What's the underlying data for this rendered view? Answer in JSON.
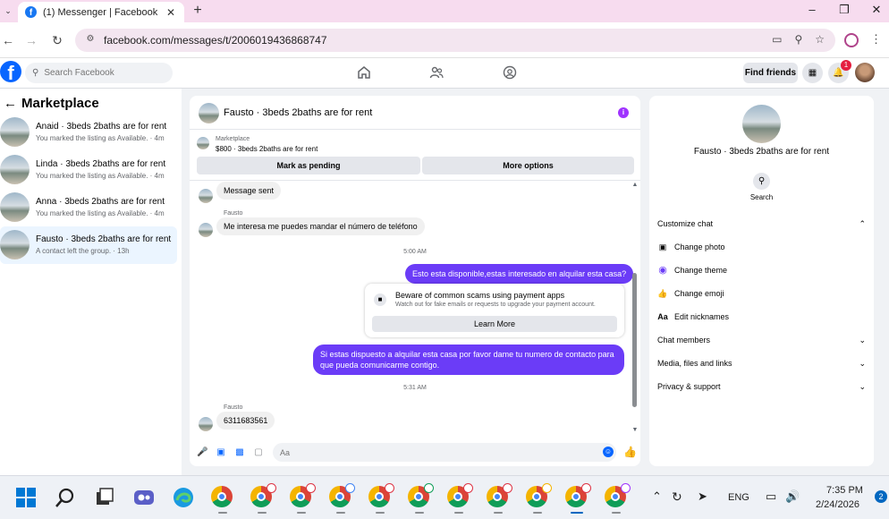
{
  "browser": {
    "tab_title": "(1) Messenger | Facebook",
    "url": "facebook.com/messages/t/2006019436868747"
  },
  "header": {
    "search_placeholder": "Search Facebook",
    "find_friends": "Find friends",
    "notifications_count": "1"
  },
  "sidebar": {
    "title": "Marketplace",
    "conversations": [
      {
        "name": "Anaid · 3beds 2baths are for rent",
        "subtitle": "You marked the listing as Available. · 4m"
      },
      {
        "name": "Linda · 3beds 2baths are for rent",
        "subtitle": "You marked the listing as Available. · 4m"
      },
      {
        "name": "Anna · 3beds 2baths are for rent",
        "subtitle": "You marked the listing as Available. · 4m"
      },
      {
        "name": "Fausto · 3beds 2baths are for rent",
        "subtitle": "A contact left the group. · 13h"
      }
    ]
  },
  "chat": {
    "title": "Fausto · 3beds 2baths are for rent",
    "listing_label": "Marketplace",
    "listing_price": "$800 · 3beds 2baths are for rent",
    "mark_pending": "Mark as pending",
    "more_options": "More options",
    "messages": {
      "m1": "Message sent",
      "sender1": "Fausto",
      "m2": "Me interesa me puedes mandar el número de teléfono",
      "time1": "5:00 AM",
      "m3": "Esto esta disponible,estas interesado en alquilar esta  casa?",
      "scam_title": "Beware of common scams using payment apps",
      "scam_sub": "Watch out for fake emails or requests to upgrade your payment account.",
      "learn_more": "Learn More",
      "m4": "Si estas dispuesto a alquilar esta casa por favor dame tu numero de contacto para que pueda comunicarme contigo.",
      "time2": "5:31 AM",
      "sender2": "Fausto",
      "m5": "6311683561"
    },
    "composer_placeholder": "Aa"
  },
  "details": {
    "name": "Fausto · 3beds 2baths are for rent",
    "search_label": "Search",
    "customize_chat": "Customize chat",
    "change_photo": "Change photo",
    "change_theme": "Change theme",
    "change_emoji": "Change emoji",
    "edit_nicknames_icon": "Aa",
    "edit_nicknames": "Edit nicknames",
    "chat_members": "Chat members",
    "media_files_links": "Media, files and links",
    "privacy_support": "Privacy & support"
  },
  "taskbar": {
    "language": "ENG",
    "time": "7:35 PM",
    "date": "2/24/2026",
    "notification_count": "2"
  },
  "colors": {
    "accent": "#0866ff",
    "outgoing_bubble": "#6b3cf7",
    "tab_strip": "#f7dcef"
  }
}
